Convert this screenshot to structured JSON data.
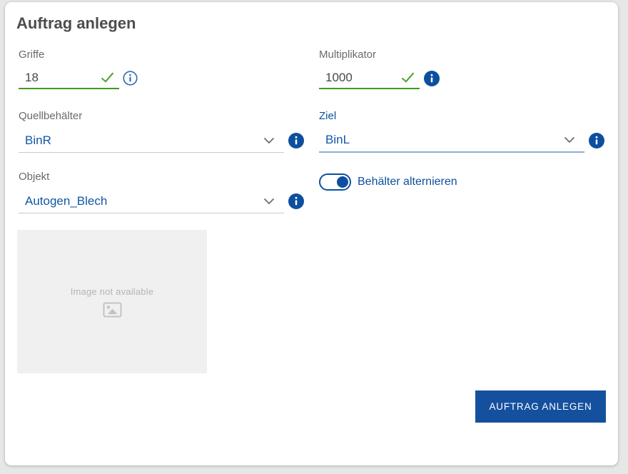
{
  "title": "Auftrag anlegen",
  "fields": {
    "griffe": {
      "label": "Griffe",
      "value": "18",
      "type": "text",
      "status": "valid"
    },
    "multiplikator": {
      "label": "Multiplikator",
      "value": "1000",
      "type": "text",
      "status": "valid"
    },
    "quellbehaelter": {
      "label": "Quellbehälter",
      "value": "BinR",
      "type": "select"
    },
    "ziel": {
      "label": "Ziel",
      "value": "BinL",
      "type": "select",
      "focused": true
    },
    "objekt": {
      "label": "Objekt",
      "value": "Autogen_Blech",
      "type": "select"
    }
  },
  "toggle": {
    "label": "Behälter alternieren",
    "state": "on"
  },
  "image_placeholder": {
    "text": "Image not available",
    "icon": "image-icon"
  },
  "submit_button": {
    "label": "AUFTRAG ANLEGEN"
  },
  "icons": {
    "valid": "check-icon",
    "info_outline": "info-icon",
    "info_filled": "info-icon",
    "dropdown": "chevron-down-icon"
  },
  "colors": {
    "primary_blue": "#0d4f9e",
    "value_blue": "#1157a6",
    "valid_green": "#3f9c19",
    "check_green": "#4aa32a",
    "title_gray": "#4d4d4d",
    "label_gray": "#6a6a6a",
    "underline_gray": "#c9c9c9",
    "focus_underline_blue": "#8fafd9",
    "page_background": "#e7e7e7",
    "placeholder_background": "#f0f0f0",
    "button_background": "#15509e"
  }
}
